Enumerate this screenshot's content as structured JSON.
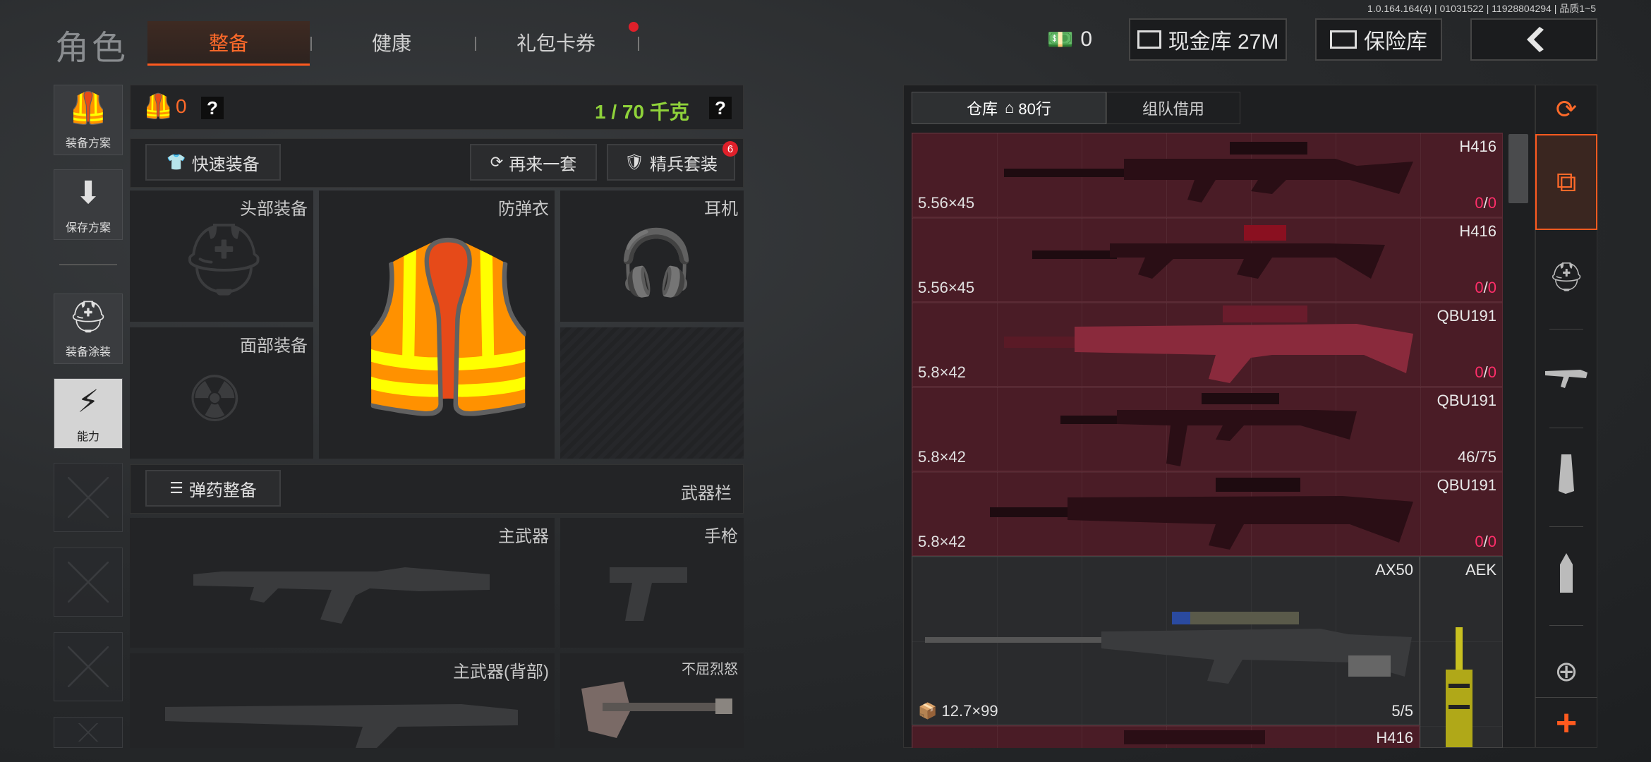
{
  "version_text": "1.0.164.164(4) | 01031522 | 11928804294 | 品质1~5",
  "title": "角色",
  "tabs": [
    {
      "label": "整备",
      "active": true
    },
    {
      "label": "健康",
      "active": false
    },
    {
      "label": "礼包卡券",
      "active": false,
      "has_notification": true
    }
  ],
  "top_right": {
    "currency_value": "0",
    "cash_vault_label": "现金库 27M",
    "safe_box_label": "保险库",
    "back_icon": "chevron-left-icon"
  },
  "left_nav": [
    {
      "label": "装备方案",
      "icon": "vest-icon"
    },
    {
      "label": "保存方案",
      "icon": "download-icon"
    },
    {
      "label": "装备涂装",
      "icon": "helmet-skin-icon"
    },
    {
      "label": "能力",
      "icon": "lightning-icon",
      "active": true
    }
  ],
  "equip_header": {
    "armor_count": "0",
    "weight": "1 / 70 千克",
    "help": "?"
  },
  "buttons": {
    "quick_equip": "快速装备",
    "another_set": "再来一套",
    "elite_set": "精兵套装",
    "elite_badge": "6",
    "ammo_equip": "弹药整备"
  },
  "slots": {
    "head": "头部装备",
    "vest": "防弹衣",
    "headset": "耳机",
    "face": "面部装备",
    "weapon_bar": "武器栏",
    "primary": "主武器",
    "pistol": "手枪",
    "primary_back": "主武器(背部)",
    "melee": "不屈烈怒"
  },
  "inventory": {
    "tab_storage": "仓库",
    "tab_rows": "80行",
    "tab_team": "组队借用",
    "items": [
      {
        "name": "H416",
        "caliber": "5.56×45",
        "ammo_cur": "0",
        "ammo_max": "0",
        "red": true
      },
      {
        "name": "H416",
        "caliber": "5.56×45",
        "ammo_cur": "0",
        "ammo_max": "0",
        "red": true
      },
      {
        "name": "QBU191",
        "caliber": "5.8×42",
        "ammo_cur": "0",
        "ammo_max": "0",
        "red": true
      },
      {
        "name": "QBU191",
        "caliber": "5.8×42",
        "ammo_text": "46/75",
        "red": false
      },
      {
        "name": "QBU191",
        "caliber": "5.8×42",
        "ammo_cur": "0",
        "ammo_max": "0",
        "red": true
      }
    ],
    "big_item": {
      "name": "AX50",
      "caliber": "12.7×99",
      "ammo_text": "5/5"
    },
    "side_item": {
      "name": "AEK"
    },
    "bottom_item": {
      "name": "H416"
    }
  },
  "right_bar_icons": [
    "layers-refresh-icon",
    "sort-layers-icon",
    "helmet-icon",
    "rifle-icon",
    "magazine-icon",
    "bullet-icon",
    "scope-icon",
    "plus-icon"
  ],
  "colors": {
    "accent": "#ff5a1f",
    "weight_green": "#8fd23a",
    "ammo_red": "#ff2e6a"
  }
}
